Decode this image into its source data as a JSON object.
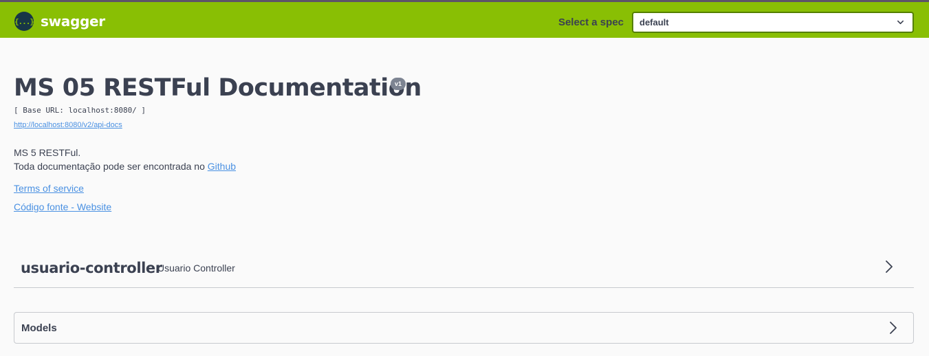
{
  "topbar": {
    "logo_symbol": "{...}",
    "logo_text": "swagger",
    "select_label": "Select a spec",
    "select_value": "default",
    "colors": {
      "bar": "#89bf04",
      "accent_border": "#547f00"
    }
  },
  "info": {
    "title": "MS 05 RESTFul Documentation",
    "version": "v1",
    "base_url": "[ Base URL: localhost:8080/ ]",
    "api_docs_url": "http://localhost:8080/v2/api-docs",
    "description_line1": "MS 5 RESTFul.",
    "description_line2_prefix": "Toda documentação pode ser encontrada no ",
    "description_link": "Github",
    "terms_link": "Terms of service",
    "source_link": "Código fonte - Website"
  },
  "controllers": [
    {
      "name": "usuario-controller",
      "description": "Usuario Controller",
      "icon": "chevron-right-icon"
    }
  ],
  "models": {
    "title": "Models",
    "icon": "chevron-right-icon"
  }
}
